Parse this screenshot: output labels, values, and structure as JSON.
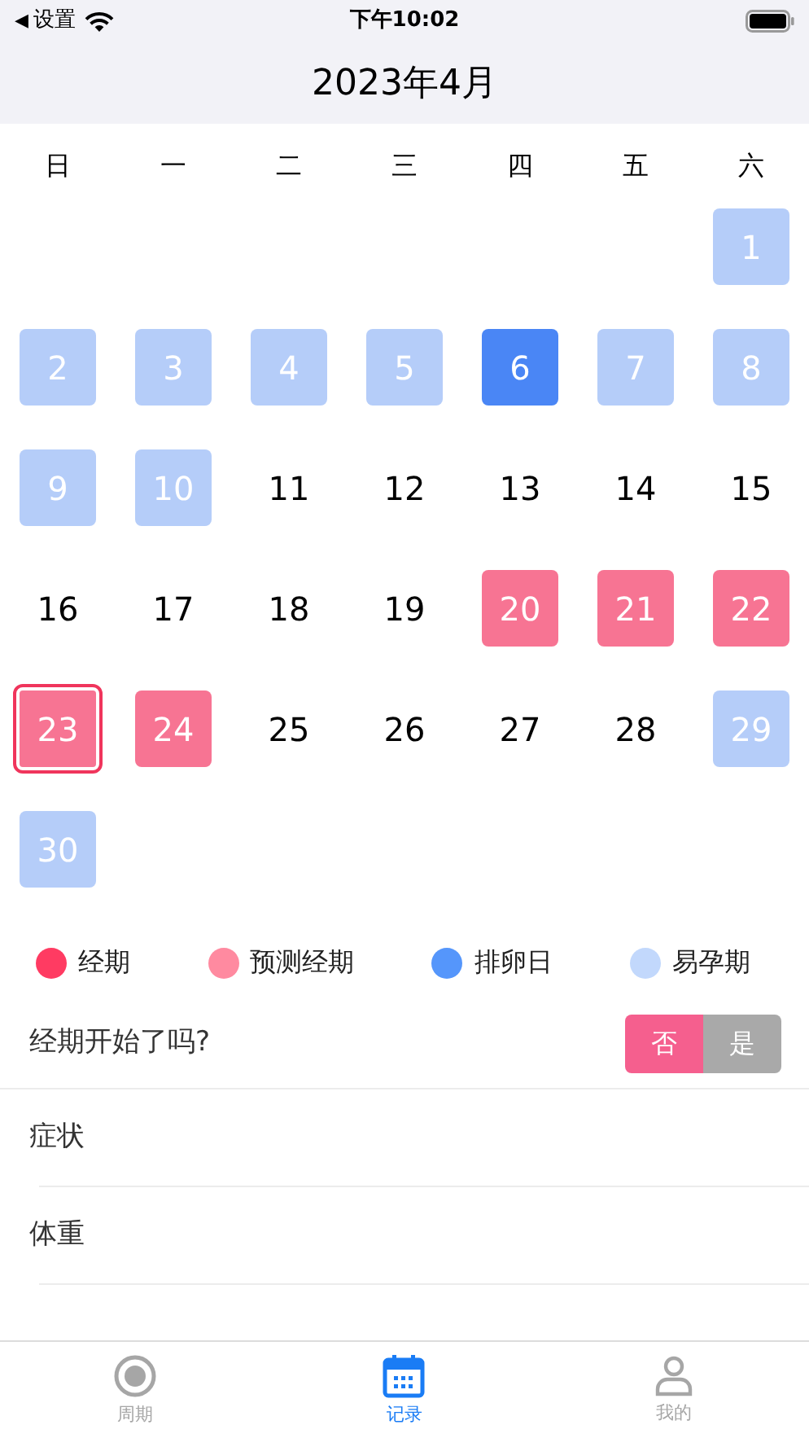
{
  "status_bar": {
    "back_arrow": "◀",
    "back_label": "设置",
    "time": "下午10:02"
  },
  "header": {
    "title": "2023年4月"
  },
  "weekdays": [
    "日",
    "一",
    "二",
    "三",
    "四",
    "五",
    "六"
  ],
  "days": [
    {
      "label": "1",
      "kind": "fertile",
      "selected": false
    },
    {
      "label": "2",
      "kind": "fertile",
      "selected": false
    },
    {
      "label": "3",
      "kind": "fertile",
      "selected": false
    },
    {
      "label": "4",
      "kind": "fertile",
      "selected": false
    },
    {
      "label": "5",
      "kind": "fertile",
      "selected": false
    },
    {
      "label": "6",
      "kind": "ovulation",
      "selected": false
    },
    {
      "label": "7",
      "kind": "fertile",
      "selected": false
    },
    {
      "label": "8",
      "kind": "fertile",
      "selected": false
    },
    {
      "label": "9",
      "kind": "fertile",
      "selected": false
    },
    {
      "label": "10",
      "kind": "fertile",
      "selected": false
    },
    {
      "label": "11",
      "kind": "normal",
      "selected": false
    },
    {
      "label": "12",
      "kind": "normal",
      "selected": false
    },
    {
      "label": "13",
      "kind": "normal",
      "selected": false
    },
    {
      "label": "14",
      "kind": "normal",
      "selected": false
    },
    {
      "label": "15",
      "kind": "normal",
      "selected": false
    },
    {
      "label": "16",
      "kind": "normal",
      "selected": false
    },
    {
      "label": "17",
      "kind": "normal",
      "selected": false
    },
    {
      "label": "18",
      "kind": "normal",
      "selected": false
    },
    {
      "label": "19",
      "kind": "normal",
      "selected": false
    },
    {
      "label": "20",
      "kind": "period",
      "selected": false
    },
    {
      "label": "21",
      "kind": "period",
      "selected": false
    },
    {
      "label": "22",
      "kind": "period",
      "selected": false
    },
    {
      "label": "23",
      "kind": "period",
      "selected": true
    },
    {
      "label": "24",
      "kind": "period",
      "selected": false
    },
    {
      "label": "25",
      "kind": "normal",
      "selected": false
    },
    {
      "label": "26",
      "kind": "normal",
      "selected": false
    },
    {
      "label": "27",
      "kind": "normal",
      "selected": false
    },
    {
      "label": "28",
      "kind": "normal",
      "selected": false
    },
    {
      "label": "29",
      "kind": "fertile",
      "selected": false
    },
    {
      "label": "30",
      "kind": "fertile",
      "selected": false
    }
  ],
  "legend": [
    {
      "label": "经期",
      "color": "#ff3b62"
    },
    {
      "label": "预测经期",
      "color": "#ff8aa0"
    },
    {
      "label": "排卵日",
      "color": "#5596fb"
    },
    {
      "label": "易孕期",
      "color": "#c2d8fc"
    }
  ],
  "question": {
    "label": "经期开始了吗?",
    "options": [
      {
        "label": "否",
        "selected": true
      },
      {
        "label": "是",
        "selected": false
      }
    ]
  },
  "records": [
    "症状",
    "体重"
  ],
  "tabs": [
    {
      "label": "周期",
      "selected": false
    },
    {
      "label": "记录",
      "selected": true
    },
    {
      "label": "我的",
      "selected": false
    }
  ]
}
